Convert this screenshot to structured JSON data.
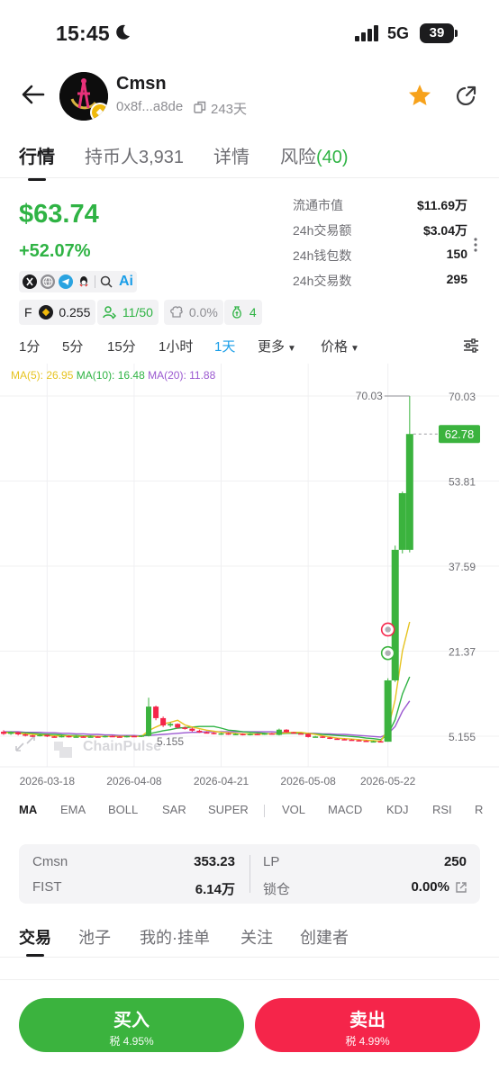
{
  "status_bar": {
    "time": "15:45",
    "network": "5G",
    "battery": "39"
  },
  "header": {
    "token_name": "Cmsn",
    "address": "0x8f...a8de",
    "age": "243天"
  },
  "tabs": [
    {
      "label": "行情",
      "count": ""
    },
    {
      "label": "持币人",
      "count": "3,931"
    },
    {
      "label": "详情",
      "count": ""
    },
    {
      "label": "风险",
      "count": "(40)"
    }
  ],
  "price": {
    "value": "$63.74",
    "change": "+52.07%"
  },
  "stats": [
    {
      "label": "流通市值",
      "value": "$11.69万"
    },
    {
      "label": "24h交易额",
      "value": "$3.04万"
    },
    {
      "label": "24h钱包数",
      "value": "150"
    },
    {
      "label": "24h交易数",
      "value": "295"
    }
  ],
  "social": {
    "icons": [
      "x-icon",
      "globe-icon",
      "telegram-icon",
      "qq-icon",
      "search-icon"
    ],
    "ai_label": "Ai"
  },
  "chips": [
    {
      "icon": "four-meme-icon",
      "prefix": "F",
      "value": "0.255"
    },
    {
      "icon": "holders-icon",
      "value": "11/50"
    },
    {
      "icon": "chef-hat-icon",
      "value": "0.0%"
    },
    {
      "icon": "money-bag-icon",
      "value": "4"
    }
  ],
  "timeframes": [
    {
      "label": "1分",
      "active": false
    },
    {
      "label": "5分",
      "active": false
    },
    {
      "label": "15分",
      "active": false
    },
    {
      "label": "1小时",
      "active": false
    },
    {
      "label": "1天",
      "active": true
    },
    {
      "label": "更多",
      "active": false
    },
    {
      "label": "价格",
      "active": false
    }
  ],
  "ma_legend": {
    "ma5": "MA(5): 26.95",
    "ma10": "MA(10): 16.48",
    "ma20": "MA(20): 11.88"
  },
  "chart_data": {
    "type": "candlestick",
    "title": "",
    "watermark": "ChainPulse",
    "y_ticks": [
      "70.03",
      "53.81",
      "37.59",
      "21.37",
      "5.155"
    ],
    "y_range": [
      5.155,
      70.03
    ],
    "x_ticks": [
      "2026-03-18",
      "2026-04-08",
      "2026-04-21",
      "2026-05-08",
      "2026-05-22"
    ],
    "current_price_label": "62.78",
    "high_label": "70.03",
    "low_label": "5.155",
    "up_color": "#3bb33e",
    "down_color": "#f5254a",
    "candles": [
      {
        "o": 6.0,
        "c": 5.6,
        "h": 6.3,
        "l": 5.4
      },
      {
        "o": 5.6,
        "c": 5.9,
        "h": 6.1,
        "l": 5.4
      },
      {
        "o": 5.9,
        "c": 5.5,
        "h": 6.0,
        "l": 5.3
      },
      {
        "o": 5.5,
        "c": 5.3,
        "h": 5.7,
        "l": 5.1
      },
      {
        "o": 5.3,
        "c": 5.2,
        "h": 5.4,
        "l": 5.0
      },
      {
        "o": 5.2,
        "c": 5.4,
        "h": 5.6,
        "l": 5.1
      },
      {
        "o": 5.4,
        "c": 5.1,
        "h": 5.5,
        "l": 5.0
      },
      {
        "o": 5.1,
        "c": 5.0,
        "h": 5.2,
        "l": 4.9
      },
      {
        "o": 5.0,
        "c": 5.2,
        "h": 5.3,
        "l": 4.9
      },
      {
        "o": 5.2,
        "c": 5.0,
        "h": 5.3,
        "l": 4.9
      },
      {
        "o": 5.0,
        "c": 5.1,
        "h": 5.2,
        "l": 4.9
      },
      {
        "o": 5.1,
        "c": 5.0,
        "h": 5.2,
        "l": 4.9
      },
      {
        "o": 5.0,
        "c": 5.1,
        "h": 5.2,
        "l": 4.9
      },
      {
        "o": 5.1,
        "c": 5.0,
        "h": 5.2,
        "l": 4.9
      },
      {
        "o": 5.0,
        "c": 5.2,
        "h": 5.3,
        "l": 4.9
      },
      {
        "o": 5.2,
        "c": 5.1,
        "h": 5.3,
        "l": 5.0
      },
      {
        "o": 5.1,
        "c": 5.0,
        "h": 5.2,
        "l": 4.9
      },
      {
        "o": 5.0,
        "c": 5.2,
        "h": 5.3,
        "l": 4.9
      },
      {
        "o": 5.2,
        "c": 5.1,
        "h": 5.3,
        "l": 5.0
      },
      {
        "o": 5.1,
        "c": 5.3,
        "h": 5.4,
        "l": 5.0
      },
      {
        "o": 5.2,
        "c": 10.8,
        "h": 12.5,
        "l": 5.1
      },
      {
        "o": 10.8,
        "c": 8.6,
        "h": 11.0,
        "l": 8.2
      },
      {
        "o": 8.6,
        "c": 7.2,
        "h": 8.9,
        "l": 6.9
      },
      {
        "o": 7.2,
        "c": 7.5,
        "h": 7.8,
        "l": 6.9
      },
      {
        "o": 7.5,
        "c": 6.8,
        "h": 7.6,
        "l": 6.6
      },
      {
        "o": 6.8,
        "c": 6.6,
        "h": 7.0,
        "l": 6.4
      },
      {
        "o": 6.6,
        "c": 6.2,
        "h": 6.8,
        "l": 6.0
      },
      {
        "o": 6.2,
        "c": 5.9,
        "h": 6.4,
        "l": 5.8
      },
      {
        "o": 5.9,
        "c": 5.8,
        "h": 6.1,
        "l": 5.7
      },
      {
        "o": 5.8,
        "c": 5.6,
        "h": 5.9,
        "l": 5.5
      },
      {
        "o": 5.6,
        "c": 5.7,
        "h": 5.8,
        "l": 5.4
      },
      {
        "o": 5.7,
        "c": 5.5,
        "h": 5.8,
        "l": 5.4
      },
      {
        "o": 5.5,
        "c": 5.6,
        "h": 5.7,
        "l": 5.4
      },
      {
        "o": 5.6,
        "c": 5.4,
        "h": 5.7,
        "l": 5.3
      },
      {
        "o": 5.4,
        "c": 5.6,
        "h": 5.7,
        "l": 5.3
      },
      {
        "o": 5.6,
        "c": 5.5,
        "h": 5.7,
        "l": 5.4
      },
      {
        "o": 5.5,
        "c": 5.7,
        "h": 5.8,
        "l": 5.4
      },
      {
        "o": 5.7,
        "c": 5.6,
        "h": 5.8,
        "l": 5.5
      },
      {
        "o": 5.4,
        "c": 6.4,
        "h": 6.6,
        "l": 5.3
      },
      {
        "o": 6.4,
        "c": 5.9,
        "h": 6.5,
        "l": 5.8
      },
      {
        "o": 5.9,
        "c": 5.7,
        "h": 6.0,
        "l": 5.6
      },
      {
        "o": 5.7,
        "c": 5.6,
        "h": 5.8,
        "l": 5.5
      },
      {
        "o": 5.6,
        "c": 5.0,
        "h": 5.7,
        "l": 4.9
      },
      {
        "o": 5.0,
        "c": 5.1,
        "h": 5.2,
        "l": 4.9
      },
      {
        "o": 5.1,
        "c": 4.9,
        "h": 5.2,
        "l": 4.8
      },
      {
        "o": 4.9,
        "c": 4.7,
        "h": 5.0,
        "l": 4.6
      },
      {
        "o": 4.7,
        "c": 4.6,
        "h": 4.8,
        "l": 4.5
      },
      {
        "o": 4.6,
        "c": 4.5,
        "h": 4.7,
        "l": 4.4
      },
      {
        "o": 4.5,
        "c": 4.4,
        "h": 4.6,
        "l": 4.3
      },
      {
        "o": 4.4,
        "c": 4.3,
        "h": 4.5,
        "l": 4.2
      },
      {
        "o": 4.3,
        "c": 4.2,
        "h": 4.4,
        "l": 4.1
      },
      {
        "o": 4.2,
        "c": 4.2,
        "h": 4.3,
        "l": 4.1
      },
      {
        "o": 4.2,
        "c": 4.1,
        "h": 4.3,
        "l": 4.0
      },
      {
        "o": 4.1,
        "c": 15.8,
        "h": 16.2,
        "l": 4.1
      },
      {
        "o": 15.8,
        "c": 40.7,
        "h": 41.5,
        "l": 15.5
      },
      {
        "o": 40.7,
        "c": 51.5,
        "h": 51.8,
        "l": 40.0
      },
      {
        "o": 40.7,
        "c": 62.78,
        "h": 70.03,
        "l": 40.2
      }
    ],
    "ma5": [
      5.8,
      5.8,
      5.7,
      5.6,
      5.5,
      5.4,
      5.3,
      5.2,
      5.2,
      5.2,
      5.1,
      5.1,
      5.1,
      5.1,
      5.1,
      5.1,
      5.1,
      5.1,
      5.1,
      5.1,
      6.2,
      6.9,
      7.5,
      7.8,
      8.2,
      7.3,
      6.9,
      6.6,
      6.3,
      6.1,
      5.9,
      5.8,
      5.7,
      5.6,
      5.6,
      5.5,
      5.6,
      5.6,
      5.7,
      5.8,
      5.9,
      5.9,
      5.7,
      5.5,
      5.2,
      5.0,
      4.8,
      4.7,
      4.6,
      4.5,
      4.4,
      4.3,
      4.2,
      6.4,
      12.1,
      21.4,
      26.95
    ],
    "ma10": [
      5.9,
      5.9,
      5.8,
      5.8,
      5.7,
      5.6,
      5.5,
      5.5,
      5.4,
      5.3,
      5.3,
      5.2,
      5.2,
      5.1,
      5.1,
      5.1,
      5.1,
      5.1,
      5.1,
      5.1,
      5.6,
      5.9,
      6.2,
      6.4,
      6.7,
      6.8,
      6.9,
      7.0,
      7.0,
      7.0,
      6.7,
      6.3,
      6.2,
      6.0,
      5.9,
      5.8,
      5.7,
      5.6,
      5.6,
      5.7,
      5.7,
      5.7,
      5.7,
      5.6,
      5.5,
      5.4,
      5.3,
      5.2,
      5.1,
      5.0,
      4.8,
      4.7,
      4.5,
      5.5,
      8.3,
      13.2,
      16.48
    ],
    "ma20": [
      6.0,
      6.0,
      6.0,
      5.9,
      5.9,
      5.9,
      5.8,
      5.8,
      5.7,
      5.7,
      5.6,
      5.6,
      5.5,
      5.5,
      5.4,
      5.4,
      5.3,
      5.3,
      5.3,
      5.2,
      5.3,
      5.4,
      5.5,
      5.6,
      5.7,
      5.8,
      5.9,
      5.9,
      6.0,
      6.0,
      6.0,
      6.0,
      6.0,
      6.0,
      6.0,
      6.0,
      6.0,
      6.0,
      5.9,
      5.9,
      5.8,
      5.8,
      5.7,
      5.7,
      5.6,
      5.6,
      5.5,
      5.5,
      5.4,
      5.3,
      5.2,
      5.1,
      5.0,
      5.6,
      7.0,
      9.9,
      11.88
    ],
    "markers": [
      {
        "index": 53,
        "value": 25.5,
        "kind": "sell"
      },
      {
        "index": 53,
        "value": 21.0,
        "kind": "buy"
      }
    ]
  },
  "indicators": [
    {
      "label": "MA",
      "active": true
    },
    {
      "label": "EMA",
      "active": false
    },
    {
      "label": "BOLL",
      "active": false
    },
    {
      "label": "SAR",
      "active": false
    },
    {
      "label": "SUPER",
      "active": false
    },
    {
      "label": "VOL",
      "active": false
    },
    {
      "label": "MACD",
      "active": false
    },
    {
      "label": "KDJ",
      "active": false
    },
    {
      "label": "RSI",
      "active": false
    },
    {
      "label": "R",
      "active": false
    }
  ],
  "pool": {
    "token_label": "Cmsn",
    "token_value": "353.23",
    "quote_label": "FIST",
    "quote_value": "6.14万",
    "lp_label": "LP",
    "lp_value": "250",
    "lock_label": "锁仓",
    "lock_value": "0.00%"
  },
  "sub_tabs": [
    {
      "label": "交易"
    },
    {
      "label": "池子"
    },
    {
      "label": "我的·挂单"
    },
    {
      "label": "关注"
    },
    {
      "label": "创建者"
    }
  ],
  "buy": {
    "label": "买入",
    "tax": "税 4.95%"
  },
  "sell": {
    "label": "卖出",
    "tax": "税 4.99%"
  }
}
